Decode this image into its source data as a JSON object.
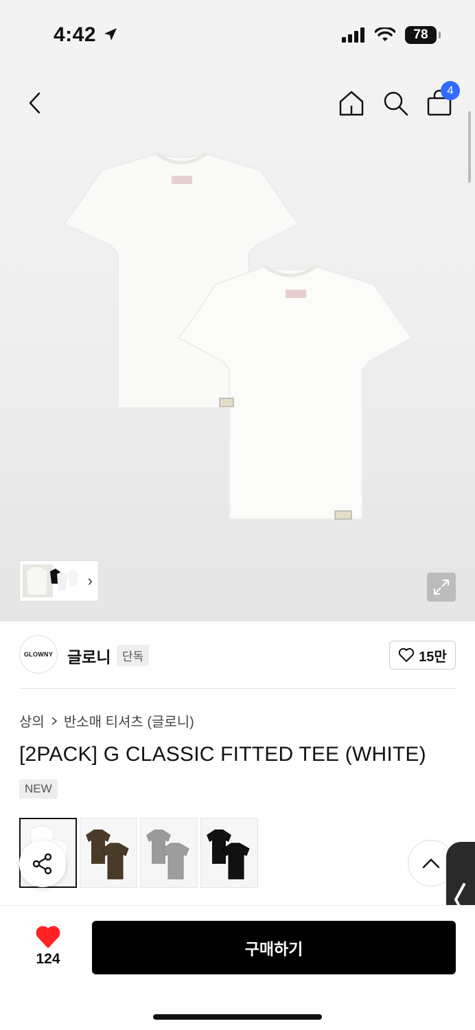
{
  "status_bar": {
    "time": "4:42",
    "battery": "78"
  },
  "header": {
    "cart_count": "4"
  },
  "brand": {
    "logo_text": "GLOWNY",
    "name": "글로니",
    "tag": "단독",
    "likes": "15만"
  },
  "breadcrumb": {
    "category": "상의",
    "subcategory": "반소매 티셔츠 (글로니)"
  },
  "product": {
    "title": "[2PACK] G CLASSIC FITTED TEE (WHITE)",
    "badge": "NEW"
  },
  "color_options": [
    {
      "name": "white",
      "color": "#ffffff",
      "selected": true
    },
    {
      "name": "brown",
      "color": "#4a3a28"
    },
    {
      "name": "gray",
      "color": "#9a9a9a"
    },
    {
      "name": "black",
      "color": "#111111"
    }
  ],
  "bottom_bar": {
    "wish_count": "124",
    "buy_label": "구매하기"
  },
  "colors": {
    "accent_blue": "#2f6bff",
    "heart_red": "#ff2222",
    "buy_black": "#000000"
  }
}
